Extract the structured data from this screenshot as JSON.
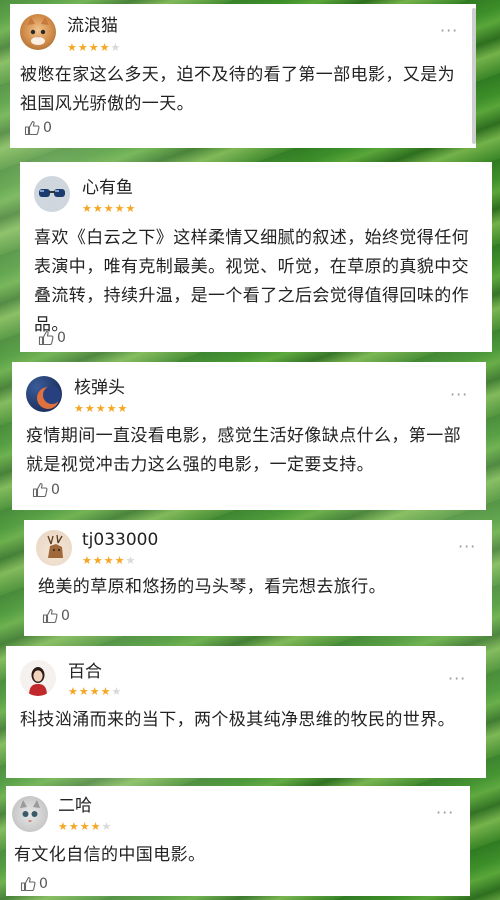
{
  "comments": [
    {
      "username": "流浪猫",
      "rating": 4,
      "content": "被憋在家这么多天，迫不及待的看了第一部电影，又是为祖国风光骄傲的一天。",
      "likes": "0",
      "avatar": "cat-avatar",
      "more": "···"
    },
    {
      "username": "心有鱼",
      "rating": 5,
      "content": "喜欢《白云之下》这样柔情又细腻的叙述，始终觉得任何表演中，唯有克制最美。视觉、听觉，在草原的真貌中交叠流转，持续升温，是一个看了之后会觉得值得回味的作品。",
      "likes": "0",
      "avatar": "sunglasses-avatar",
      "more": ""
    },
    {
      "username": "核弹头",
      "rating": 5,
      "content": "疫情期间一直没看电影，感觉生活好像缺点什么，第一部就是视觉冲击力这么强的电影，一定要支持。",
      "likes": "0",
      "avatar": "moon-avatar",
      "more": "···"
    },
    {
      "username": "tj033000",
      "rating": 4,
      "content": "绝美的草原和悠扬的马头琴，看完想去旅行。",
      "likes": "0",
      "avatar": "deer-avatar",
      "more": "···"
    },
    {
      "username": "百合",
      "rating": 4,
      "content": "科技汹涌而来的当下，两个极其纯净思维的牧民的世界。",
      "likes": "",
      "avatar": "girl-avatar",
      "more": "···"
    },
    {
      "username": "二哈",
      "rating": 4,
      "content": "有文化自信的中国电影。",
      "likes": "0",
      "avatar": "kitten-avatar",
      "more": "···"
    }
  ],
  "colors": {
    "star_on": "#f5a623",
    "star_off": "#d9d9d9",
    "background": "#3b8a2a"
  }
}
